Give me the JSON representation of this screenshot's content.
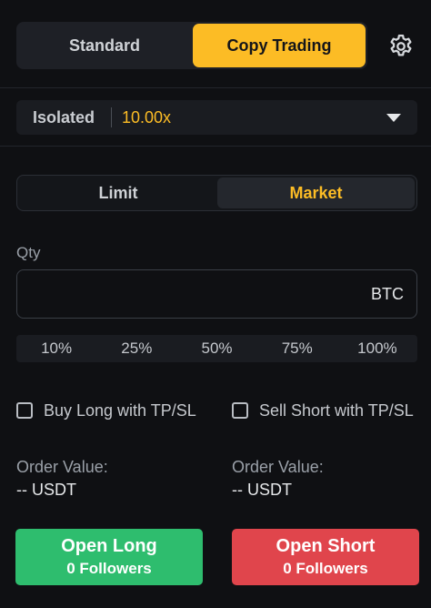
{
  "mode_tabs": {
    "standard": "Standard",
    "copy_trading": "Copy Trading",
    "active": "Copy Trading"
  },
  "settings_icon": "gear-icon",
  "margin": {
    "mode": "Isolated",
    "leverage": "10.00x",
    "dropdown_icon": "caret-down-icon"
  },
  "order_type": {
    "limit": "Limit",
    "market": "Market",
    "active": "Market"
  },
  "qty": {
    "label": "Qty",
    "value": "",
    "unit": "BTC"
  },
  "percentages": [
    "10%",
    "25%",
    "50%",
    "75%",
    "100%"
  ],
  "tpsl": {
    "buy_long": "Buy Long with TP/SL",
    "sell_short": "Sell Short with TP/SL",
    "buy_long_checked": false,
    "sell_short_checked": false
  },
  "order_value": {
    "left": {
      "label": "Order Value:",
      "value": "-- USDT"
    },
    "right": {
      "label": "Order Value:",
      "value": "-- USDT"
    }
  },
  "buttons": {
    "long": {
      "title": "Open Long",
      "followers": "0 Followers"
    },
    "short": {
      "title": "Open Short",
      "followers": "0 Followers"
    }
  },
  "colors": {
    "accent": "#fcbc25",
    "long": "#2ebd6e",
    "short": "#e0454c",
    "background": "#0f1013"
  }
}
